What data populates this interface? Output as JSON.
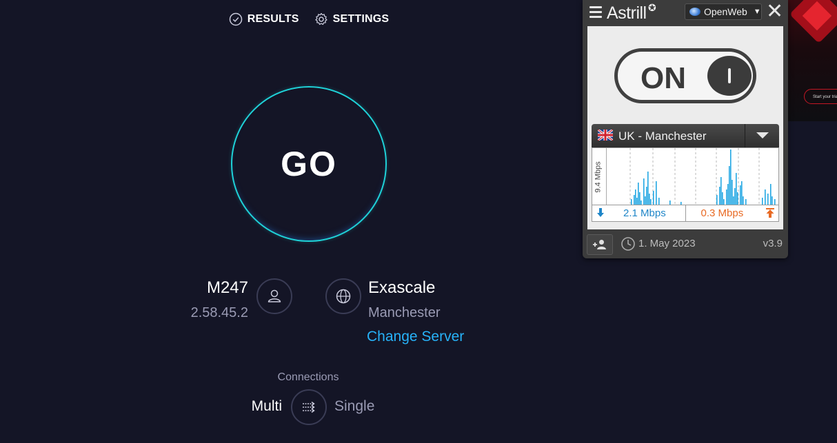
{
  "nav": {
    "results_label": "RESULTS",
    "settings_label": "SETTINGS"
  },
  "go_label": "GO",
  "isp": {
    "name": "M247",
    "ip": "2.58.45.2"
  },
  "server": {
    "name": "Exascale",
    "location": "Manchester",
    "change_label": "Change Server"
  },
  "connections": {
    "label": "Connections",
    "multi_label": "Multi",
    "single_label": "Single",
    "selected": "Multi"
  },
  "thumbnail": {
    "pill_text": "Start your trial"
  },
  "astrill": {
    "brand": "Astrill",
    "protocol": "OpenWeb",
    "state_label": "ON",
    "server_name": "UK - Manchester",
    "graph_ylabel": "9.4 Mbps",
    "download_speed": "2.1 Mbps",
    "upload_speed": "0.3 Mbps",
    "date": "1. May 2023",
    "version": "v3.9",
    "colors": {
      "download": "#1f86c8",
      "upload": "#e86a24",
      "graph_bar": "#22a7e3"
    }
  }
}
